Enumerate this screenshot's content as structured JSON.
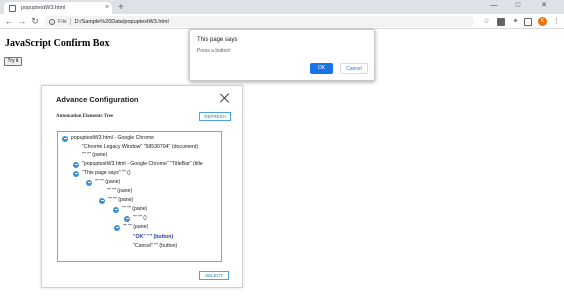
{
  "browser": {
    "tab_title": "popuptestW3.html",
    "tab_close": "×",
    "new_tab": "+",
    "window_controls": {
      "minimize": "—",
      "maximize": "□",
      "close": "✕"
    },
    "nav": {
      "back": "←",
      "forward": "→",
      "reload": "↻"
    },
    "omnibox": {
      "info": "i",
      "site_label": "File",
      "url": "D:/Sample%20Data/popuptestW3.html"
    },
    "toolbar_icons": {
      "star": "☆",
      "extension_puzzle": "✦",
      "menu": "⋮"
    },
    "profile_initial": "K"
  },
  "page": {
    "title": "JavaScript Confirm Box",
    "try_button": "Try it"
  },
  "confirm_dialog": {
    "title": "This page says",
    "message": "Press a button!",
    "ok_label": "OK",
    "cancel_label": "Cancel"
  },
  "advance_config": {
    "title": "Advance Configuration",
    "tree_label": "Automation Elements Tree",
    "refresh_label": "REFRESH",
    "select_label": "SELECT",
    "tree": [
      {
        "text": "popuptestW3.html - Google Chrome",
        "has_toggle": true,
        "highlight": false
      },
      {
        "text": "\"Chrome Legacy Window\" \"58530704\"   (document)",
        "has_toggle": false,
        "highlight": false
      },
      {
        "text": "\"\" \"\"     (pane)",
        "has_toggle": false,
        "highlight": false
      },
      {
        "text": "\"popuptestW3.html - Google Chrome\" \"TitleBar\"   (title",
        "has_toggle": true,
        "highlight": false
      },
      {
        "text": "\"This page says\" \"\"     ()",
        "has_toggle": true,
        "highlight": false
      },
      {
        "text": "\"\" \"\"     (pane)",
        "has_toggle": true,
        "highlight": false
      },
      {
        "text": "\"\" \"\"     (pane)",
        "has_toggle": false,
        "highlight": false
      },
      {
        "text": "\"\" \"\"     (pane)",
        "has_toggle": true,
        "highlight": false
      },
      {
        "text": "\"\" \"\"     (pane)",
        "has_toggle": true,
        "highlight": false
      },
      {
        "text": "\"\" \"\"     ()",
        "has_toggle": true,
        "highlight": false
      },
      {
        "text": "\"\" \"\"     (pane)",
        "has_toggle": true,
        "highlight": false
      },
      {
        "text": "\"OK\" \"\"     (button)",
        "has_toggle": false,
        "highlight": true
      },
      {
        "text": "\"Cancel\" \"\"     (button)",
        "has_toggle": false,
        "highlight": false
      }
    ]
  }
}
